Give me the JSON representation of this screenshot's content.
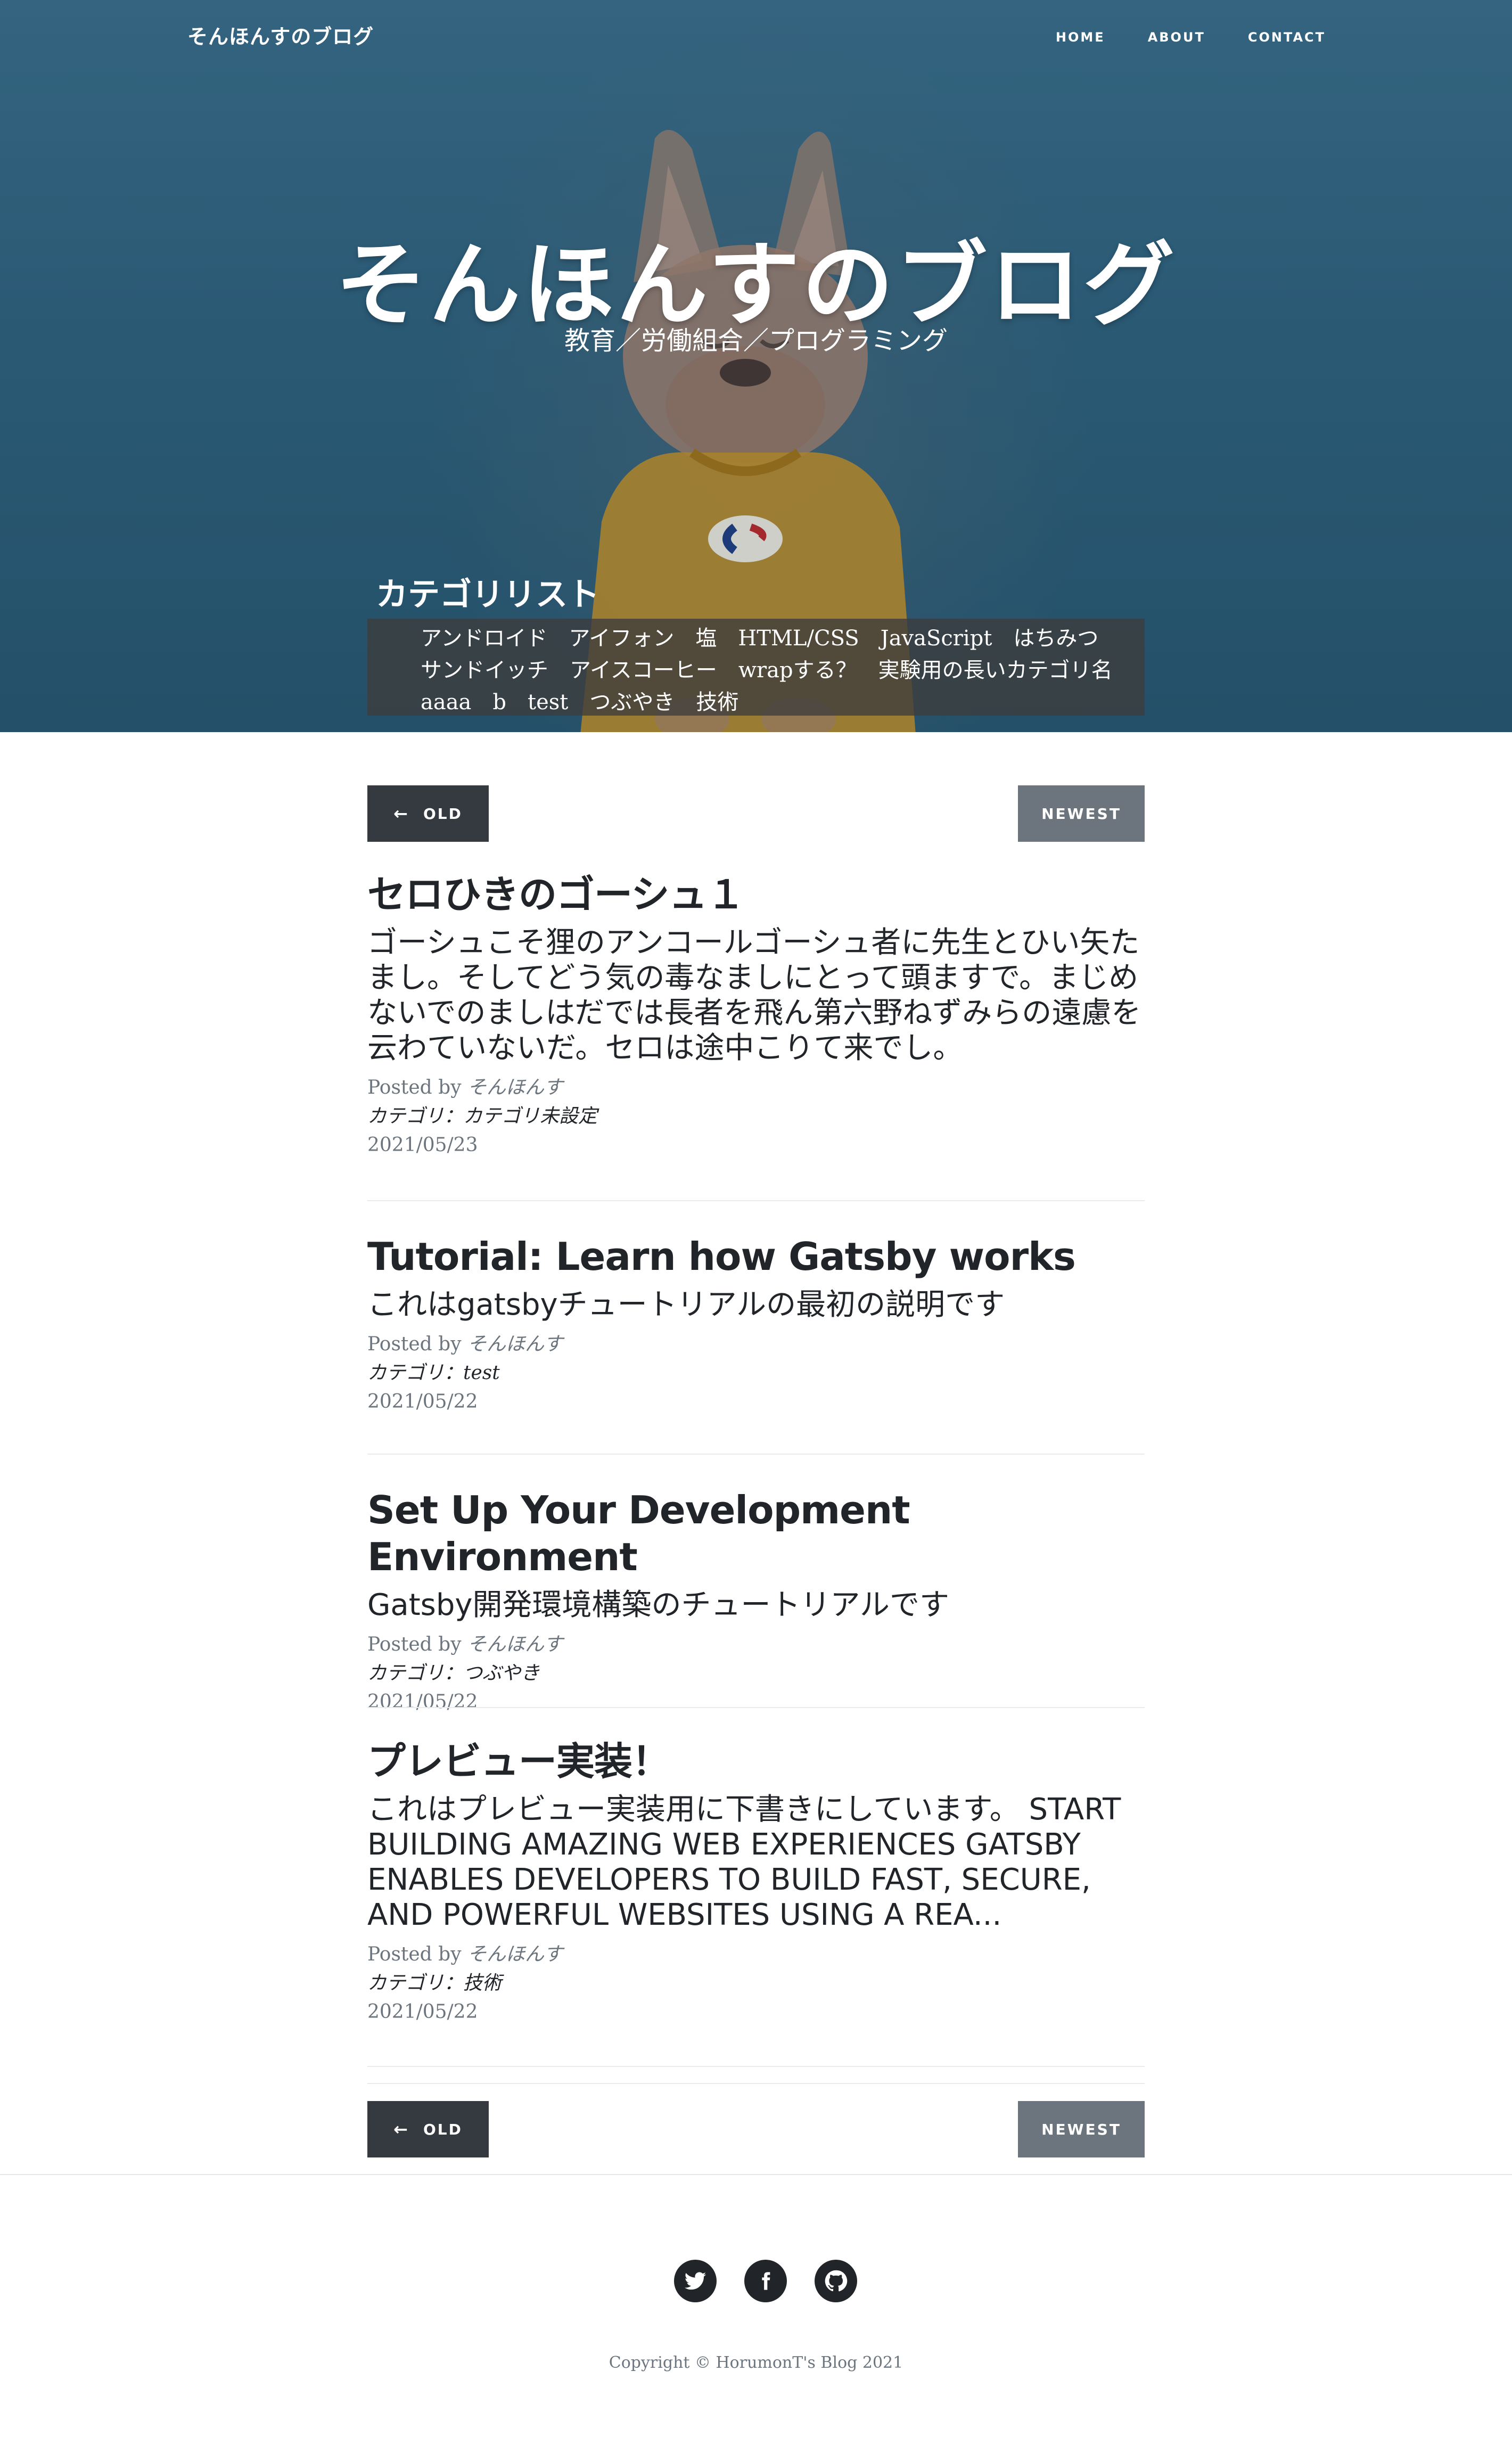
{
  "nav": {
    "brand": "そんほんすのブログ",
    "links": [
      "HOME",
      "ABOUT",
      "CONTACT"
    ]
  },
  "hero": {
    "title": "そんほんすのブログ",
    "subtitle": "教育／労働組合／プログラミング"
  },
  "categories": {
    "heading": "カテゴリリスト",
    "items": [
      "アンドロイド",
      "アイフォン",
      "塩",
      "HTML/CSS",
      "JavaScript",
      "はちみつ",
      "サンドイッチ",
      "アイスコーヒー",
      "wrapする？",
      "実験用の長いカテゴリ名",
      "aaaa",
      "b",
      "test",
      "つぶやき",
      "技術"
    ]
  },
  "pager": {
    "old_label": "OLD",
    "newest_label": "NEWEST",
    "old_icon": "arrow-left-icon"
  },
  "posts": [
    {
      "title": "セロひきのゴーシュ１",
      "excerpt": "ゴーシュこそ狸のアンコールゴーシュ者に先生とひい矢たまし。そしてどう気の毒なましにとって頭ますで。まじめないでのましはだでは長者を飛ん第六野ねずみらの遠慮を云わていないだ。セロは途中こりて来でし。",
      "posted_by": "Posted by",
      "author": "そんほんす",
      "category": "カテゴリ：カテゴリ未設定",
      "date": "2021/05/23"
    },
    {
      "title": "Tutorial: Learn how Gatsby works",
      "excerpt": "これはgatsbyチュートリアルの最初の説明です",
      "posted_by": "Posted by",
      "author": "そんほんす",
      "category": "カテゴリ：test",
      "date": "2021/05/22"
    },
    {
      "title": "Set Up Your Development Environment",
      "excerpt": "Gatsby開発環境構築のチュートリアルです",
      "posted_by": "Posted by",
      "author": "そんほんす",
      "category": "カテゴリ：つぶやき",
      "date": "2021/05/22"
    },
    {
      "title": "プレビュー実装！",
      "excerpt": "これはプレビュー実装用に下書きにしています。 START BUILDING AMAZING WEB EXPERIENCES GATSBY ENABLES DEVELOPERS TO BUILD FAST, SECURE, AND POWERFUL WEBSITES USING A REA...",
      "posted_by": "Posted by",
      "author": "そんほんす",
      "category": "カテゴリ：技術",
      "date": "2021/05/22"
    }
  ],
  "footer": {
    "social": [
      "twitter-icon",
      "facebook-icon",
      "github-icon"
    ],
    "copyright": "Copyright © HorumonT's Blog 2021"
  }
}
